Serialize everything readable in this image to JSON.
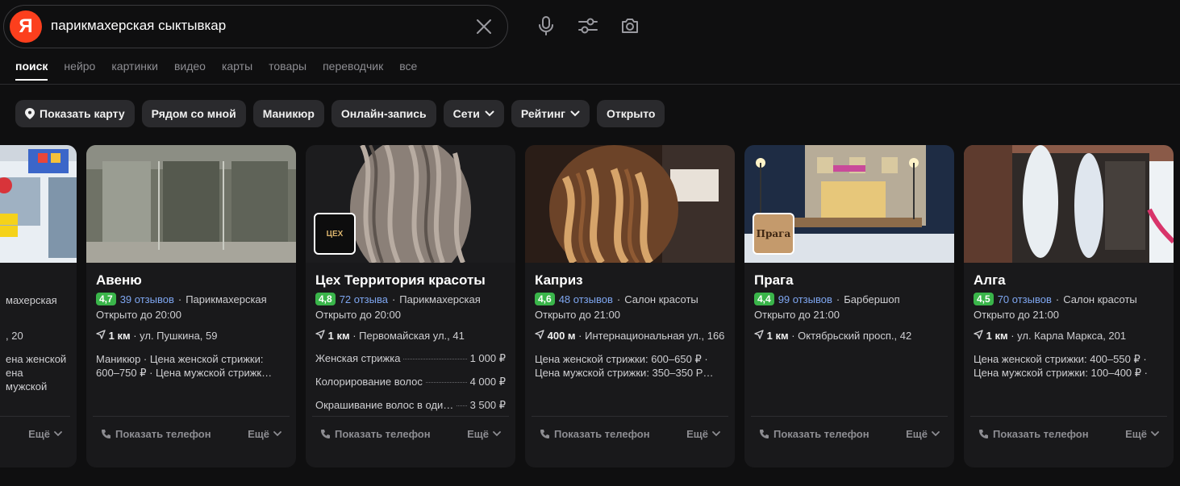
{
  "search": {
    "query": "парикмахерская сыктывкар",
    "logo_letter": "Я"
  },
  "tabs": [
    "поиск",
    "нейро",
    "картинки",
    "видео",
    "карты",
    "товары",
    "переводчик",
    "все"
  ],
  "chips": [
    {
      "label": "Показать карту",
      "icon": "location-pin-icon"
    },
    {
      "label": "Рядом со мной"
    },
    {
      "label": "Маникюр"
    },
    {
      "label": "Онлайн-запись"
    },
    {
      "label": "Сети",
      "dropdown": true
    },
    {
      "label": "Рейтинг",
      "dropdown": true
    },
    {
      "label": "Открыто"
    }
  ],
  "cards": {
    "partial": {
      "type_fragment": "махерская",
      "addr_fragment": ", 20",
      "desc_line1": "ена женской",
      "desc_line2": "ена мужской",
      "more": "Ещё"
    },
    "aveny": {
      "name": "Авеню",
      "rating": "4,7",
      "reviews": "39 отзывов",
      "type": "Парикмахерская",
      "open": "Открыто до 20:00",
      "distance": "1 км",
      "address": "ул. Пушкина, 59",
      "desc": "Маникюр · Цена женской стрижки: 600–750 ₽ · Цена мужской стрижк…",
      "phone": "Показать телефон",
      "more": "Ещё"
    },
    "cex": {
      "name": "Цех Территория красоты",
      "rating": "4,8",
      "reviews": "72 отзыва",
      "type": "Парикмахерская",
      "open": "Открыто до 20:00",
      "distance": "1 км",
      "address": "Первомайская ул., 41",
      "logo_text": "ЦЕХ",
      "prices": [
        {
          "service": "Женская стрижка",
          "price": "1 000 ₽"
        },
        {
          "service": "Колорирование волос",
          "price": "4 000 ₽"
        },
        {
          "service": "Окрашивание волос в оди…",
          "price": "3 500 ₽"
        }
      ],
      "phone": "Показать телефон",
      "more": "Ещё"
    },
    "kapriz": {
      "name": "Каприз",
      "rating": "4,6",
      "reviews": "48 отзывов",
      "type": "Салон красоты",
      "open": "Открыто до 21:00",
      "distance": "400 м",
      "address": "Интернациональная ул., 166",
      "desc": "Цена женской стрижки: 600–650 ₽ · Цена мужской стрижки: 350–350 Р…",
      "phone": "Показать телефон",
      "more": "Ещё"
    },
    "praga": {
      "name": "Прага",
      "rating": "4,4",
      "reviews": "99 отзывов",
      "type": "Барбершоп",
      "open": "Открыто до 21:00",
      "distance": "1 км",
      "address": "Октябрьский просп., 42",
      "logo_text": "Прага",
      "phone": "Показать телефон",
      "more": "Ещё"
    },
    "alga": {
      "name": "Алга",
      "rating": "4,5",
      "reviews": "70 отзывов",
      "type": "Салон красоты",
      "open": "Открыто до 21:00",
      "distance": "1 км",
      "address": "ул. Карла Маркса, 201",
      "desc": "Цена женской стрижки: 400–550 ₽ · Цена мужской стрижки: 100–400 ₽ ·",
      "phone": "Показать телефон",
      "more": "Ещё"
    }
  },
  "colors": {
    "background": "#0f0f10",
    "card": "#19191b",
    "chip": "#2a2a2d",
    "rating_green": "#3ab54a",
    "link_blue": "#7ea6f0",
    "logo_red": "#fc3f1d"
  }
}
